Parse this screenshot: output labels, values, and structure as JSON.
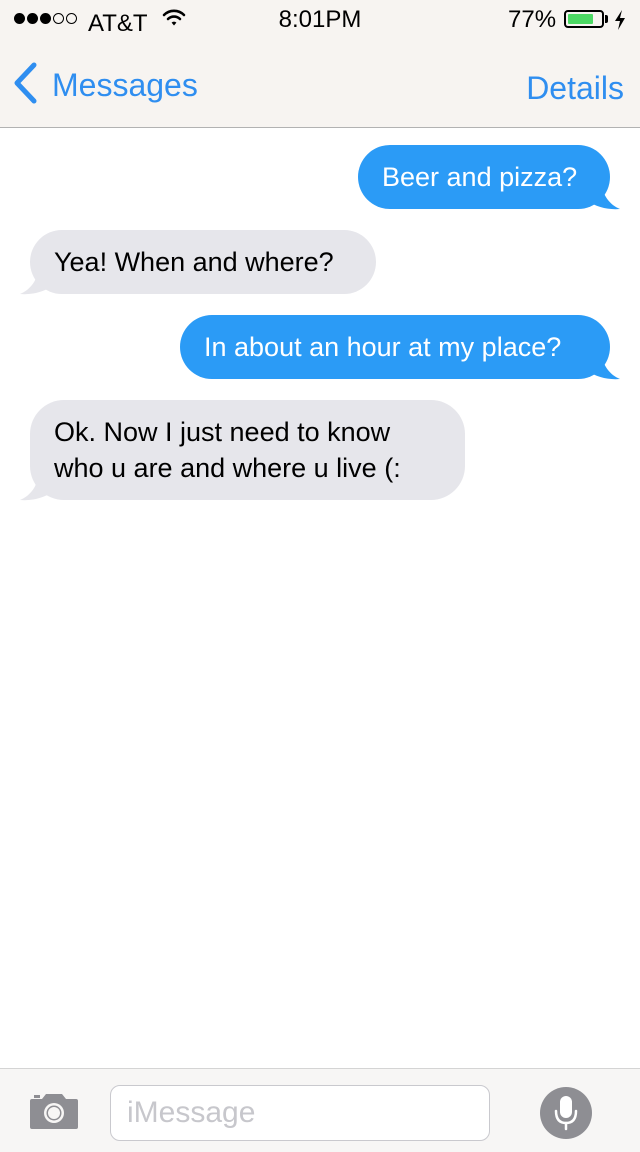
{
  "status_bar": {
    "signal_strength": 3,
    "signal_max": 5,
    "carrier": "AT&T",
    "wifi_icon": "wifi-icon",
    "time": "8:01PM",
    "battery_percent": "77%",
    "battery_level": 0.77,
    "charging_icon": "bolt-icon"
  },
  "nav": {
    "back_label": "Messages",
    "back_icon": "chevron-left-icon",
    "details_label": "Details"
  },
  "messages": [
    {
      "direction": "sent",
      "text": "Beer and pizza?"
    },
    {
      "direction": "received",
      "text": "Yea! When and where?"
    },
    {
      "direction": "sent",
      "text": "In about an hour at my place?"
    },
    {
      "direction": "received",
      "text": "Ok. Now I just need to know\nwho u are and where u live (:"
    }
  ],
  "input_bar": {
    "camera_icon": "camera-icon",
    "placeholder": "iMessage",
    "value": "",
    "mic_icon": "microphone-icon"
  },
  "colors": {
    "accent": "#2f8ef0",
    "sent_bubble": "#2b9bf6",
    "received_bubble": "#e6e6eb",
    "battery_fill": "#4cd964"
  }
}
